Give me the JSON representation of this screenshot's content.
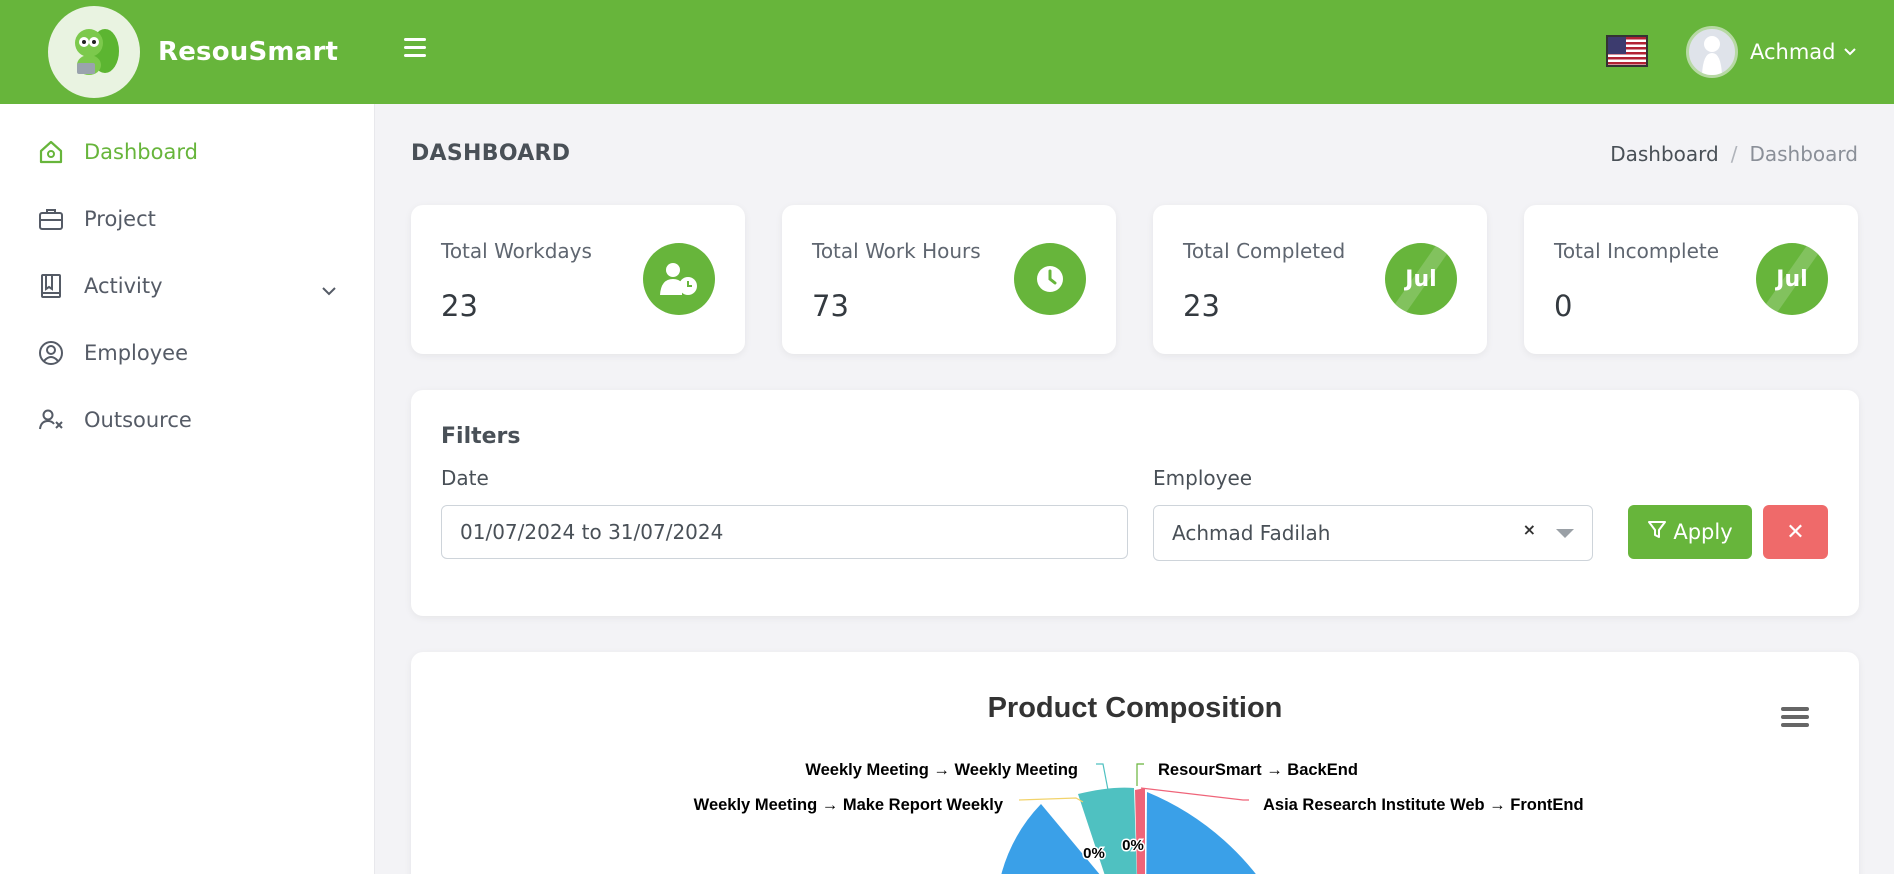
{
  "app": {
    "name": "ResouSmart"
  },
  "user": {
    "name": "Achmad"
  },
  "sidebar": {
    "items": [
      {
        "label": "Dashboard",
        "icon": "home-icon"
      },
      {
        "label": "Project",
        "icon": "briefcase-icon"
      },
      {
        "label": "Activity",
        "icon": "book-icon"
      },
      {
        "label": "Employee",
        "icon": "user-circle-icon"
      },
      {
        "label": "Outsource",
        "icon": "user-x-icon"
      }
    ]
  },
  "page": {
    "title": "DASHBOARD",
    "breadcrumb": [
      "Dashboard",
      "Dashboard"
    ],
    "breadcrumb_sep": "/"
  },
  "stats": [
    {
      "label": "Total Workdays",
      "value": "23",
      "icon": "user-clock-icon"
    },
    {
      "label": "Total Work Hours",
      "value": "73",
      "icon": "clock-icon"
    },
    {
      "label": "Total Completed",
      "value": "23",
      "badge": "Jul"
    },
    {
      "label": "Total Incomplete",
      "value": "0",
      "badge": "Jul"
    }
  ],
  "filters": {
    "title": "Filters",
    "date_label": "Date",
    "date_value": "01/07/2024 to 31/07/2024",
    "employee_label": "Employee",
    "employee_value": "Achmad Fadilah",
    "clear_symbol": "×",
    "apply_label": "Apply",
    "reset_symbol": "✕"
  },
  "colors": {
    "brand": "#67b53b",
    "danger": "#ef6a6a",
    "pie_blue": "#3aa0e8",
    "pie_teal": "#4fc1c1",
    "pie_pink": "#ef6479"
  },
  "chart_data": {
    "type": "pie",
    "title": "Product Composition",
    "slices": [
      {
        "label": "Weekly Meeting → Weekly Meeting",
        "percent": "0%"
      },
      {
        "label": "Weekly Meeting → Make Report Weekly",
        "percent": "0%"
      },
      {
        "label": "ResourSmart → BackEnd",
        "percent": "0%"
      },
      {
        "label": "Asia Research Institute Web → FrontEnd",
        "percent": ""
      }
    ]
  }
}
